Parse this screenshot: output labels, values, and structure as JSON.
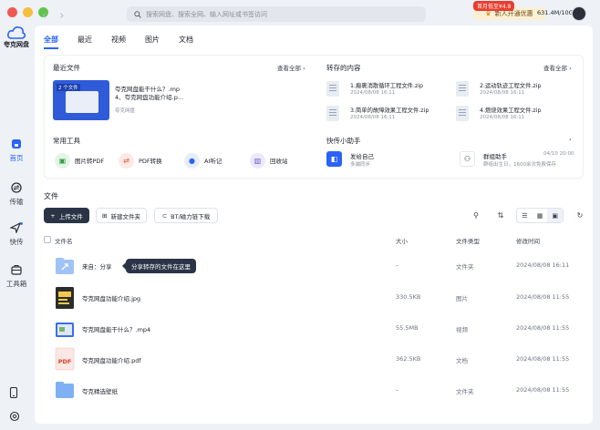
{
  "rail": {
    "logo_label": "夸克网盘",
    "items": [
      {
        "label": "首页"
      },
      {
        "label": "传输"
      },
      {
        "label": "快传"
      },
      {
        "label": "工具箱"
      }
    ]
  },
  "topbar": {
    "search_placeholder": "搜索网盘、搜索全网、输入网址或书签访问",
    "vip_badge": "首月低至¥4.8",
    "vip_label": "新人开通优惠",
    "storage": "631.4M/10G"
  },
  "tabs": [
    "全部",
    "最近",
    "视频",
    "图片",
    "文档"
  ],
  "recent": {
    "title": "最近文件",
    "see_all": "查看全部",
    "thumb_tag": "2 个文件",
    "item_line1": "夸克网盘能干什么？.mp",
    "item_line2": "4、夸克网盘功能介绍.p...",
    "item_source": "夸克网盘"
  },
  "saved": {
    "title": "转存的内容",
    "see_all": "查看全部",
    "items": [
      {
        "name": "1.瘢裹消散循环工程文件.zip",
        "date": "2024/08/08 16:11"
      },
      {
        "name": "2.运动轨迹工程文件.zip",
        "date": "2024/08/08 16:11"
      },
      {
        "name": "3.简单的故障效果工程文件.zip",
        "date": "2024/08/08 16:11"
      },
      {
        "name": "4.燃烧效果工程文件.zip",
        "date": "2024/08/08 16:11"
      }
    ]
  },
  "tools": {
    "title": "常用工具",
    "items": [
      {
        "label": "图片转PDF",
        "icon": "image-to-pdf-icon"
      },
      {
        "label": "PDF转换",
        "icon": "pdf-convert-icon"
      },
      {
        "label": "AI听记",
        "icon": "microphone-icon"
      },
      {
        "label": "回收站",
        "icon": "trash-icon"
      }
    ]
  },
  "helper": {
    "title": "快传小助手",
    "send_self_title": "发给自己",
    "send_self_sub": "多端同步",
    "group_title": "群组助手",
    "group_time": "04/10 20:00",
    "group_sub": "群组出生日，1600余次免费保存"
  },
  "files": {
    "title": "文件",
    "upload_label": "上传文件",
    "new_folder_label": "新建文件夹",
    "bt_label": "BT/磁力链下载",
    "headers": {
      "name": "文件名",
      "size": "大小",
      "type": "文件类型",
      "modified": "修改时间"
    },
    "rows": [
      {
        "name": "来自：分享",
        "size": "–",
        "type": "文件夹",
        "modified": "2024/08/08 16:11",
        "icon": "shared-folder-icon"
      },
      {
        "name": "夸克网盘功能介绍.jpg",
        "size": "330.5KB",
        "type": "图片",
        "modified": "2024/08/08 11:55",
        "icon": "image-file-icon"
      },
      {
        "name": "夸克网盘能干什么？.mp4",
        "size": "55.5MB",
        "type": "视频",
        "modified": "2024/08/08 11:55",
        "icon": "video-file-icon"
      },
      {
        "name": "夸克网盘功能介绍.pdf",
        "size": "362.5KB",
        "type": "文档",
        "modified": "2024/08/08 11:55",
        "icon": "pdf-file-icon"
      },
      {
        "name": "夸克精选壁纸",
        "size": "–",
        "type": "文件夹",
        "modified": "2024/08/08 11:55",
        "icon": "folder-icon"
      }
    ],
    "tooltip": "分享转存的文件在这里"
  },
  "colors": {
    "accent": "#2b63f5",
    "dark_button": "#2b3447",
    "vip_bg": "#fcf0d4"
  }
}
